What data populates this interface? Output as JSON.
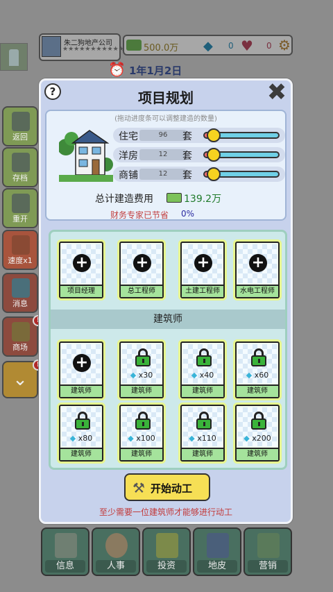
{
  "hud": {
    "company_name": "朱二狗地产公司",
    "company_stars": "★★★★★★★★★★★★",
    "money": "500.0万",
    "gems": "0",
    "hearts": "0",
    "date": "1年1月2日",
    "icons": {
      "money": "money-stack-icon",
      "gem": "diamond-icon",
      "heart": "heart-icon",
      "settings": "gear-icon",
      "clock": "alarm-clock-icon"
    }
  },
  "sidebar": {
    "items": [
      {
        "label": "返回",
        "icon": "building-icon"
      },
      {
        "label": "存档",
        "icon": "save-icon"
      },
      {
        "label": "重开",
        "icon": "restart-icon"
      },
      {
        "label": "速度x1",
        "icon": "truck-icon"
      },
      {
        "label": "消息",
        "icon": "message-icon"
      },
      {
        "label": "商场",
        "icon": "shop-star-icon",
        "badge": "!"
      }
    ],
    "collapse_badge": "!"
  },
  "bottom_nav": {
    "items": [
      {
        "label": "信息",
        "icon": "clipboard-icon"
      },
      {
        "label": "人事",
        "icon": "person-icon"
      },
      {
        "label": "投资",
        "icon": "money-icon"
      },
      {
        "label": "地皮",
        "icon": "building-icon"
      },
      {
        "label": "营销",
        "icon": "shopping-bag-icon"
      }
    ]
  },
  "modal": {
    "title": "项目规划",
    "help_symbol": "?",
    "close_symbol": "✖",
    "hint": "(拖动进度条可以调整建造的数量)",
    "rows": [
      {
        "label": "住宅",
        "value": "96",
        "unit": "套",
        "slider_fraction": 0.12
      },
      {
        "label": "洋房",
        "value": "12",
        "unit": "套",
        "slider_fraction": 0.12
      },
      {
        "label": "商铺",
        "value": "12",
        "unit": "套",
        "slider_fraction": 0.12
      }
    ],
    "cost_label": "总计建造费用",
    "cost_value": "139.2万",
    "saving_label": "财务专家已节省",
    "saving_value": "0%",
    "experts": [
      {
        "name": "项目经理",
        "state": "add"
      },
      {
        "name": "总工程师",
        "state": "add"
      },
      {
        "name": "土建工程师",
        "state": "add"
      },
      {
        "name": "水电工程师",
        "state": "add"
      }
    ],
    "architect_section": "建筑师",
    "architects": [
      {
        "name": "建筑师",
        "state": "add",
        "price": ""
      },
      {
        "name": "建筑师",
        "state": "locked",
        "price": "x30"
      },
      {
        "name": "建筑师",
        "state": "locked",
        "price": "x40"
      },
      {
        "name": "建筑师",
        "state": "locked",
        "price": "x60"
      },
      {
        "name": "建筑师",
        "state": "locked",
        "price": "x80"
      },
      {
        "name": "建筑师",
        "state": "locked",
        "price": "x100"
      },
      {
        "name": "建筑师",
        "state": "locked",
        "price": "x110"
      },
      {
        "name": "建筑师",
        "state": "locked",
        "price": "x200"
      }
    ],
    "start_label": "开始动工",
    "warning": "至少需要一位建筑师才能够进行动工",
    "colors": {
      "accent_yellow": "#f6df55",
      "card_name_green": "#a5e39c",
      "warning_red": "#c23a3a",
      "cost_green": "#1f7a2a"
    }
  }
}
